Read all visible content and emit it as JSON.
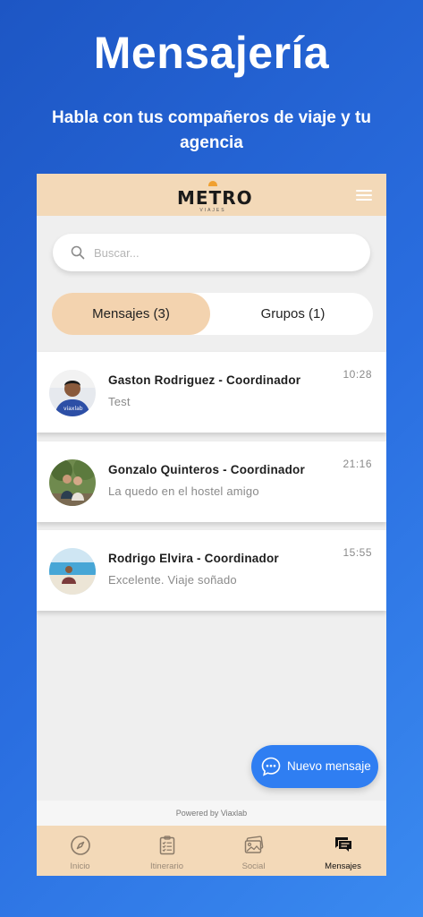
{
  "promo": {
    "title": "Mensajería",
    "subtitle": "Habla con tus compañeros de viaje y tu agencia"
  },
  "header": {
    "logo_text": "METRO",
    "logo_sub": "VIAJES",
    "menu_icon": "hamburger-menu-icon"
  },
  "search": {
    "placeholder": "Buscar...",
    "value": ""
  },
  "tabs": [
    {
      "label": "Mensajes (3)",
      "active": true
    },
    {
      "label": "Grupos (1)",
      "active": false
    }
  ],
  "conversations": [
    {
      "name": "Gaston Rodriguez - Coordinador",
      "message": "Test",
      "time": "10:28"
    },
    {
      "name": "Gonzalo Quinteros - Coordinador",
      "message": "La quedo en el hostel amigo",
      "time": "21:16"
    },
    {
      "name": "Rodrigo Elvira - Coordinador",
      "message": "Excelente. Viaje soñado",
      "time": "15:55"
    }
  ],
  "fab": {
    "label": "Nuevo mensaje",
    "icon": "chat-bubble-icon"
  },
  "powered_by": "Powered by Viaxlab",
  "tabbar": [
    {
      "label": "Inicio",
      "icon": "compass-icon",
      "active": false
    },
    {
      "label": "Itinerario",
      "icon": "clipboard-checklist-icon",
      "active": false
    },
    {
      "label": "Social",
      "icon": "photos-icon",
      "active": false
    },
    {
      "label": "Mensajes",
      "icon": "messages-icon",
      "active": true
    }
  ],
  "colors": {
    "background": "#2a6ee0",
    "header": "#f3d9b8",
    "active_tab": "#f3d3af",
    "fab": "#2f7ef2"
  }
}
